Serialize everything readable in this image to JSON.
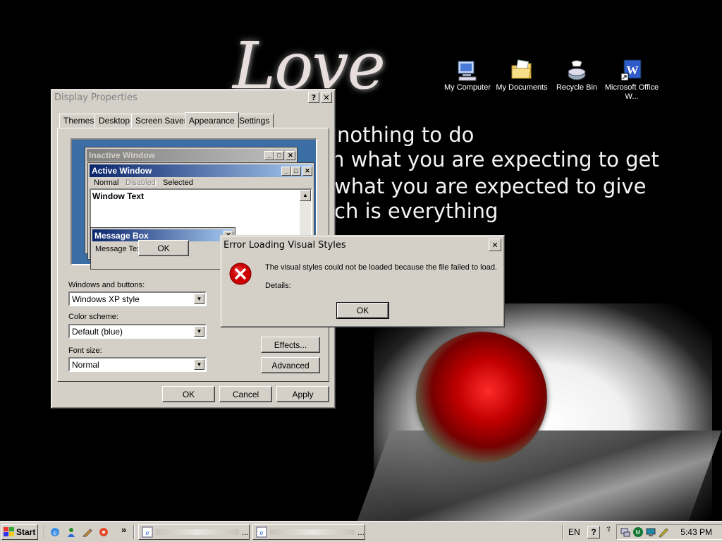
{
  "desktop": {
    "wallpaper": {
      "title": "Love",
      "lines": [
        "nothing to do",
        "n what you are expecting to get",
        "what you are expected to give",
        "ch is everything"
      ]
    },
    "icons": [
      {
        "label": "My Computer",
        "icon": "computer-icon"
      },
      {
        "label": "My Documents",
        "icon": "folder-documents-icon"
      },
      {
        "label": "Recycle Bin",
        "icon": "recycle-bin-icon"
      },
      {
        "label": "Microsoft Office W...",
        "icon": "word-shortcut-icon"
      }
    ]
  },
  "display_properties": {
    "title": "Display Properties",
    "help_btn": "?",
    "close_btn": "✕",
    "tabs": [
      "Themes",
      "Desktop",
      "Screen Saver",
      "Appearance",
      "Settings"
    ],
    "active_tab": "Appearance",
    "preview": {
      "inactive_title": "Inactive Window",
      "active_title": "Active Window",
      "menu": [
        "Normal",
        "Disabled",
        "Selected"
      ],
      "window_text": "Window Text",
      "msgbox_title": "Message Box",
      "msgbox_text": "Message Text",
      "msgbox_ok": "OK"
    },
    "windows_buttons_label": "Windows and buttons:",
    "windows_buttons_value": "Windows XP style",
    "color_scheme_label": "Color scheme:",
    "color_scheme_value": "Default (blue)",
    "font_size_label": "Font size:",
    "font_size_value": "Normal",
    "effects_btn": "Effects...",
    "advanced_btn": "Advanced",
    "ok_btn": "OK",
    "cancel_btn": "Cancel",
    "apply_btn": "Apply"
  },
  "error_dialog": {
    "title": "Error Loading Visual Styles",
    "close_btn": "✕",
    "message": "The visual styles could not be loaded because the file failed to load.",
    "details_label": "Details:",
    "ok_btn": "OK",
    "icon": "error-icon"
  },
  "taskbar": {
    "start_label": "Start",
    "quick_launch": [
      "ie-icon",
      "messenger-icon",
      "tools-icon",
      "media-icon"
    ],
    "chevron": "»",
    "tasks": [
      {
        "label": "...",
        "icon": "ie-icon"
      },
      {
        "label": "...",
        "icon": "ie-icon"
      }
    ],
    "language": "EN",
    "clock": "5:43 PM"
  },
  "colors": {
    "active_title": "#0a246a",
    "active_title_end": "#a6caf0",
    "inactive_title": "#808080",
    "inactive_title_end": "#c0c0c0",
    "error_red": "#cc0000",
    "face": "#d4d0c8"
  }
}
